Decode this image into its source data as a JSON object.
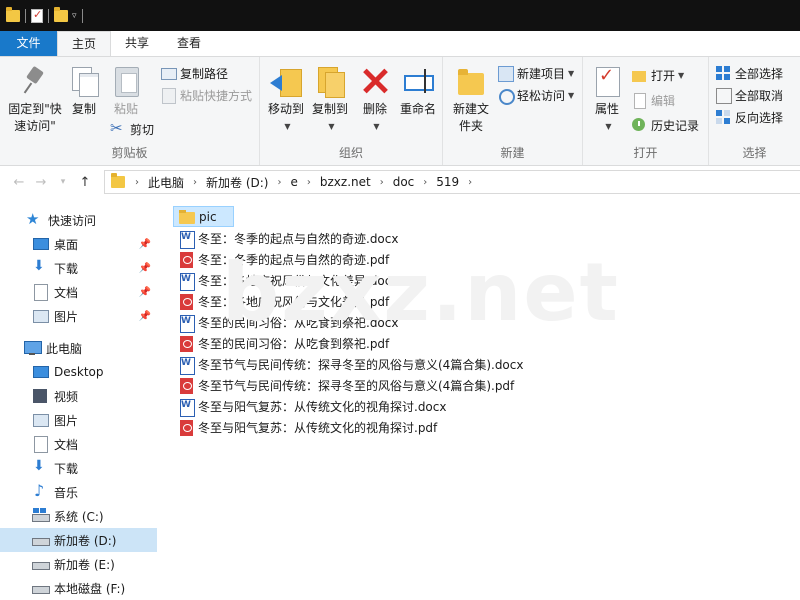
{
  "tabs": {
    "file": "文件",
    "home": "主页",
    "share": "共享",
    "view": "查看"
  },
  "ribbon": {
    "clipboard": {
      "label": "剪贴板",
      "pin": "固定到\"快速访问\"",
      "copy": "复制",
      "paste": "粘贴",
      "copy_path": "复制路径",
      "paste_shortcut": "粘贴快捷方式",
      "cut": "剪切"
    },
    "organize": {
      "label": "组织",
      "move_to": "移动到",
      "copy_to": "复制到",
      "delete": "删除",
      "rename": "重命名"
    },
    "new": {
      "label": "新建",
      "new_folder": "新建文件夹",
      "new_item": "新建项目",
      "easy_access": "轻松访问"
    },
    "open": {
      "label": "打开",
      "properties": "属性",
      "open": "打开",
      "edit": "编辑",
      "history": "历史记录"
    },
    "select": {
      "label": "选择",
      "select_all": "全部选择",
      "select_none": "全部取消",
      "invert": "反向选择"
    }
  },
  "address": {
    "crumbs": [
      "此电脑",
      "新加卷 (D:)",
      "e",
      "bzxz.net",
      "doc",
      "519"
    ]
  },
  "sidebar": {
    "items": [
      {
        "label": "快速访问"
      },
      {
        "label": "桌面"
      },
      {
        "label": "下载"
      },
      {
        "label": "文档"
      },
      {
        "label": "图片"
      },
      {
        "label": "此电脑"
      },
      {
        "label": "Desktop"
      },
      {
        "label": "视频"
      },
      {
        "label": "图片"
      },
      {
        "label": "文档"
      },
      {
        "label": "下载"
      },
      {
        "label": "音乐"
      },
      {
        "label": "系统 (C:)"
      },
      {
        "label": "新加卷 (D:)"
      },
      {
        "label": "新加卷 (E:)"
      },
      {
        "label": "本地磁盘 (F:)"
      }
    ]
  },
  "files": [
    {
      "name": "pic",
      "type": "folder"
    },
    {
      "name": "冬至：冬季的起点与自然的奇迹.docx",
      "type": "docx"
    },
    {
      "name": "冬至：冬季的起点与自然的奇迹.pdf",
      "type": "pdf"
    },
    {
      "name": "冬至：各地庆祝风俗与文化差异.docx",
      "type": "docx"
    },
    {
      "name": "冬至：各地庆祝风俗与文化差异.pdf",
      "type": "pdf"
    },
    {
      "name": "冬至的民间习俗：从吃食到祭祀.docx",
      "type": "docx"
    },
    {
      "name": "冬至的民间习俗：从吃食到祭祀.pdf",
      "type": "pdf"
    },
    {
      "name": "冬至节气与民间传统：探寻冬至的风俗与意义(4篇合集).docx",
      "type": "docx"
    },
    {
      "name": "冬至节气与民间传统：探寻冬至的风俗与意义(4篇合集).pdf",
      "type": "pdf"
    },
    {
      "name": "冬至与阳气复苏：从传统文化的视角探讨.docx",
      "type": "docx"
    },
    {
      "name": "冬至与阳气复苏：从传统文化的视角探讨.pdf",
      "type": "pdf"
    }
  ],
  "watermark": "bzxz.net"
}
